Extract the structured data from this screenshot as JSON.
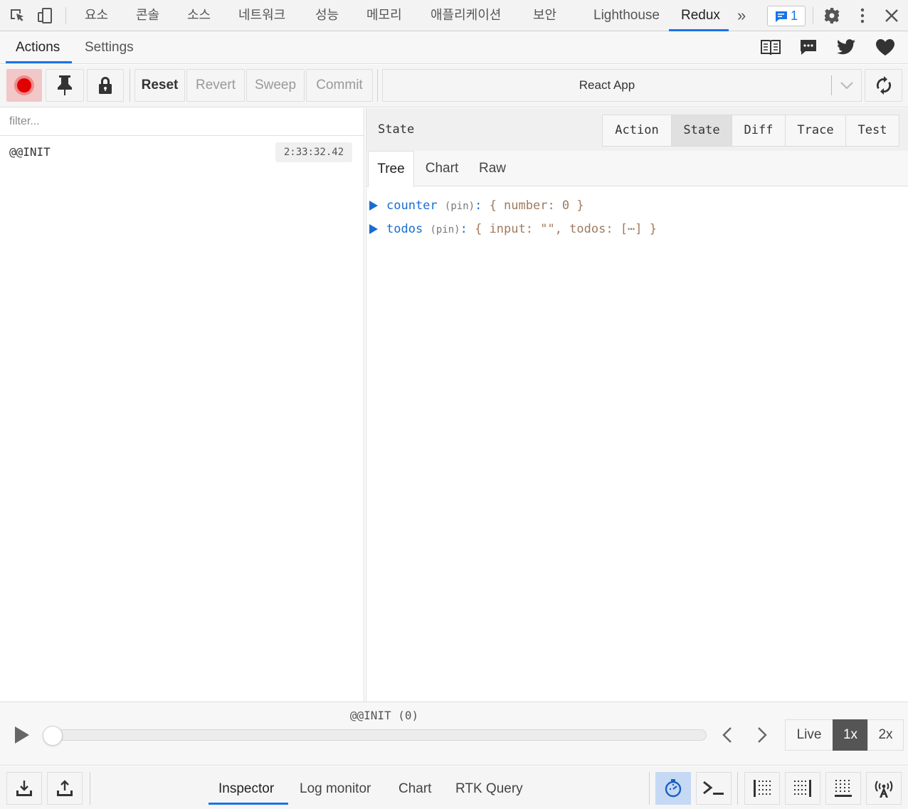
{
  "devtools": {
    "tabs": [
      "요소",
      "콘솔",
      "소스",
      "네트워크",
      "성능",
      "메모리",
      "애플리케이션",
      "보안",
      "Lighthouse",
      "Redux"
    ],
    "active_tab": "Redux",
    "more_label": "»",
    "issues_count": "1",
    "accent": "#1a73e8"
  },
  "topnav": {
    "tabs": [
      "Actions",
      "Settings"
    ],
    "active": "Actions",
    "icons": [
      "book-icon",
      "chat-icon",
      "twitter-icon",
      "heart-icon"
    ]
  },
  "toolbar": {
    "reset": "Reset",
    "revert": "Revert",
    "sweep": "Sweep",
    "commit": "Commit",
    "instance": "React App",
    "record_color": "#e00000"
  },
  "actions_panel": {
    "filter_placeholder": "filter...",
    "items": [
      {
        "name": "@@INIT",
        "time": "2:33:32.42"
      }
    ]
  },
  "state_panel": {
    "title": "State",
    "tabs": [
      "Action",
      "State",
      "Diff",
      "Trace",
      "Test"
    ],
    "active_tab": "State",
    "subtabs": [
      "Tree",
      "Chart",
      "Raw"
    ],
    "active_subtab": "Tree",
    "tree": [
      {
        "key": "counter",
        "pin": "(pin)",
        "colon": ":",
        "value": "{ number: 0 }"
      },
      {
        "key": "todos",
        "pin": "(pin)",
        "colon": ":",
        "value": "{ input: \"\", todos: [⋯] }"
      }
    ]
  },
  "slider": {
    "label": "@@INIT (0)",
    "speeds": [
      "Live",
      "1x",
      "2x"
    ],
    "active_speed": "1x",
    "position": 0
  },
  "bottom": {
    "tabs": [
      "Inspector",
      "Log monitor",
      "Chart",
      "RTK Query"
    ],
    "active": "Inspector",
    "active_icon_bg": "#c5d9f5"
  }
}
